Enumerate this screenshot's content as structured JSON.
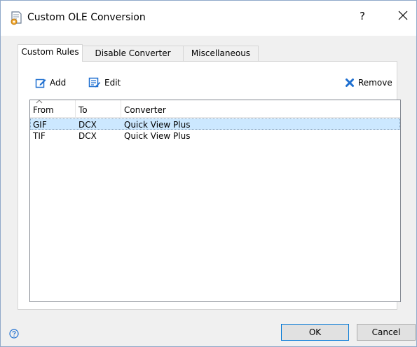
{
  "window": {
    "title": "Custom OLE Conversion",
    "help_label": "?"
  },
  "tabs": [
    {
      "label": "Custom Rules",
      "active": true
    },
    {
      "label": "Disable Converter",
      "active": false
    },
    {
      "label": "Miscellaneous",
      "active": false
    }
  ],
  "toolbar": {
    "add_label": "Add",
    "edit_label": "Edit",
    "remove_label": "Remove"
  },
  "list": {
    "columns": [
      "From",
      "To",
      "Converter"
    ],
    "sort_column": "From",
    "rows": [
      {
        "from": "GIF",
        "to": "DCX",
        "converter": "Quick View Plus",
        "selected": true
      },
      {
        "from": "TIF",
        "to": "DCX",
        "converter": "Quick View Plus",
        "selected": false
      }
    ]
  },
  "buttons": {
    "ok": "OK",
    "cancel": "Cancel"
  },
  "colors": {
    "selection": "#cce8ff",
    "accent": "#0078d7",
    "remove_icon": "#1e6fd0",
    "dialog_bg": "#f0f0f0"
  },
  "icons": {
    "title": "document-settings-icon",
    "add": "edit-pencil-icon",
    "edit": "list-edit-icon",
    "remove": "close-x-icon",
    "help": "help-circle-icon",
    "sort": "sort-ascending-icon"
  }
}
